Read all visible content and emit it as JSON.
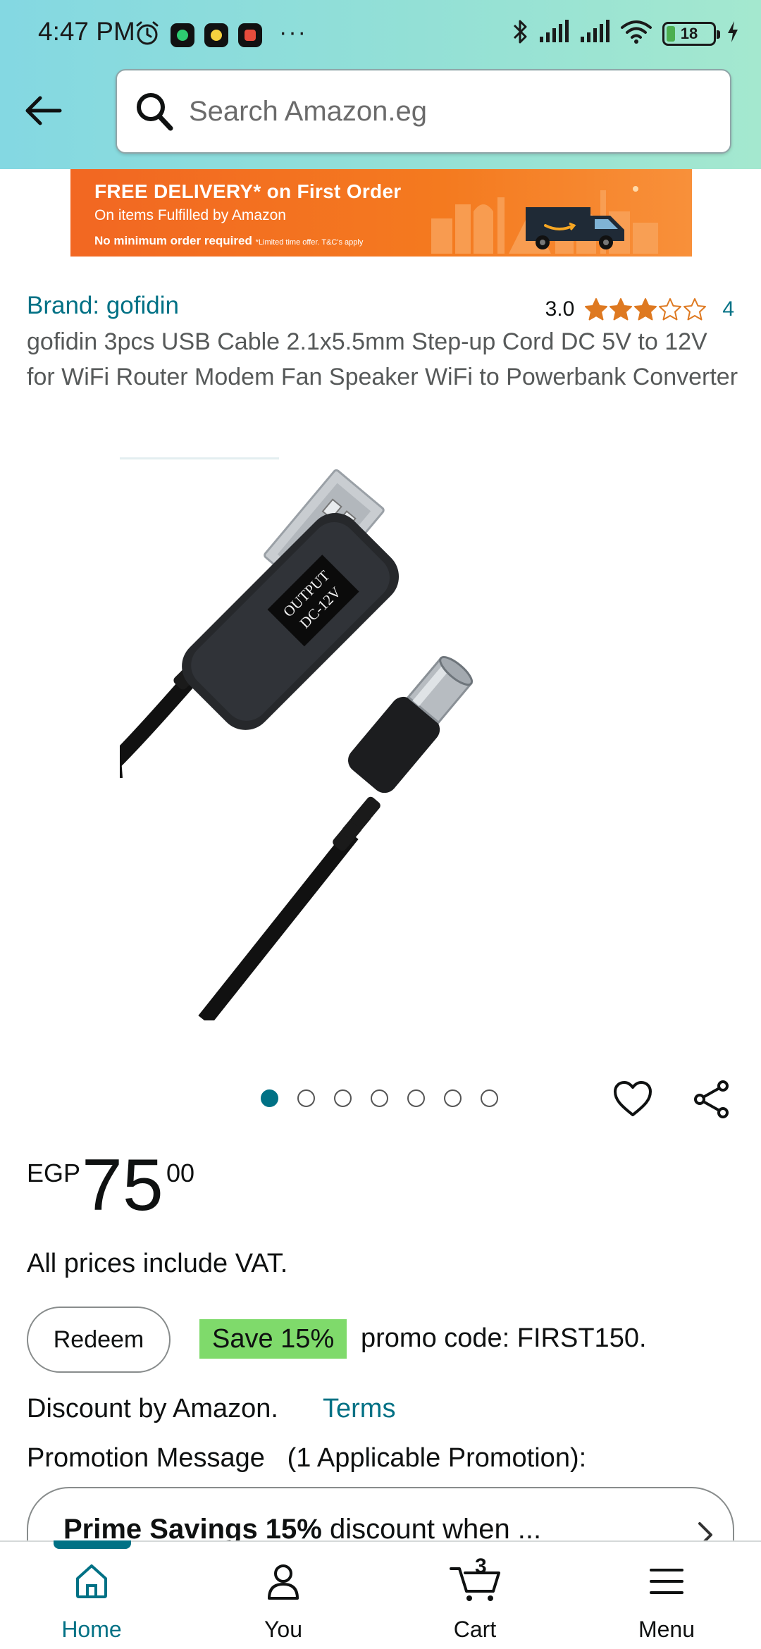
{
  "status_bar": {
    "time": "4:47 PM",
    "battery": "18",
    "battery_level": 0.18,
    "icons": [
      "alarm-icon",
      "whatsapp-icon",
      "app-icon",
      "youtube-icon",
      "more-icon",
      "bluetooth-icon",
      "signal-icon",
      "signal-icon",
      "wifi-icon",
      "battery-icon",
      "charging-icon"
    ]
  },
  "header": {
    "back_icon": "arrow-left-icon",
    "search_placeholder": "Search Amazon.eg"
  },
  "banner": {
    "title": "FREE DELIVERY* on First Order",
    "subtitle": "On items Fulfilled by Amazon",
    "note": "No minimum order required",
    "fine_print": "*Limited time offer. T&C's apply"
  },
  "product": {
    "brand": "Brand: gofidin",
    "rating": "3.0",
    "rating_stars": 3,
    "rating_count": "4",
    "title": "gofidin 3pcs USB Cable 2.1x5.5mm Step-up Cord DC 5V to 12V for WiFi Router Modem Fan Speaker WiFi to Powerbank Converter",
    "module_label_line1": "OUTPUT",
    "module_label_line2": "DC-12V",
    "image_count": 7,
    "active_image": 0
  },
  "price": {
    "currency": "EGP",
    "whole": "75",
    "fraction": "00",
    "vat_note": "All prices include VAT."
  },
  "promo": {
    "redeem_label": "Redeem",
    "save_badge": "Save 15%",
    "code_text": "promo code: FIRST150.",
    "discount_text": "Discount by Amazon.",
    "terms_label": "Terms",
    "message": "Promotion Message   (1 Applicable Promotion):",
    "card_bold": "Prime Savings 15%",
    "card_rest": " discount when ..."
  },
  "nav": {
    "items": [
      {
        "label": "Home",
        "icon": "home-icon"
      },
      {
        "label": "You",
        "icon": "user-icon"
      },
      {
        "label": "Cart",
        "icon": "cart-icon"
      },
      {
        "label": "Menu",
        "icon": "menu-icon"
      }
    ],
    "cart_count": "3",
    "active": "Home"
  },
  "colors": {
    "header_gradient_start": "#84d8e2",
    "header_gradient_end": "#a4e8cf",
    "link": "#007185",
    "star": "#de7921",
    "save_badge": "#7fda6b",
    "banner": "#f26722"
  }
}
